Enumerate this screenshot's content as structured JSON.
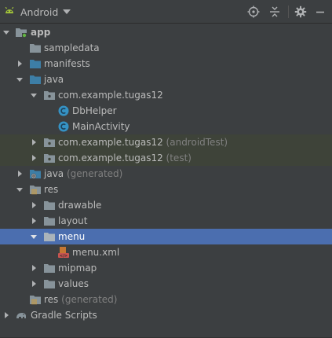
{
  "toolbar": {
    "view_label": "Android",
    "icons": [
      "android-icon",
      "target-icon",
      "collapse-icon",
      "gear-icon",
      "minimize-icon"
    ]
  },
  "tree": {
    "app": "app",
    "sampledata": "sampledata",
    "manifests": "manifests",
    "java": "java",
    "package_main": "com.example.tugas12",
    "dbhelper": "DbHelper",
    "mainactivity": "MainActivity",
    "package_android_test": "com.example.tugas12",
    "package_android_test_suffix": "(androidTest)",
    "package_test": "com.example.tugas12",
    "package_test_suffix": "(test)",
    "java_generated": "java",
    "java_generated_suffix": "(generated)",
    "res": "res",
    "drawable": "drawable",
    "layout": "layout",
    "menu": "menu",
    "menu_xml": "menu.xml",
    "mipmap": "mipmap",
    "values": "values",
    "res_generated": "res",
    "res_generated_suffix": "(generated)",
    "gradle_scripts": "Gradle Scripts"
  },
  "colors": {
    "background": "#3c3f41",
    "selection": "#4b6eaf",
    "tinted_row": "#3e4339",
    "folder": "#87939a",
    "source_folder": "#3d7ea6",
    "class_icon": "#3592c4",
    "android_green": "#a4c639"
  }
}
